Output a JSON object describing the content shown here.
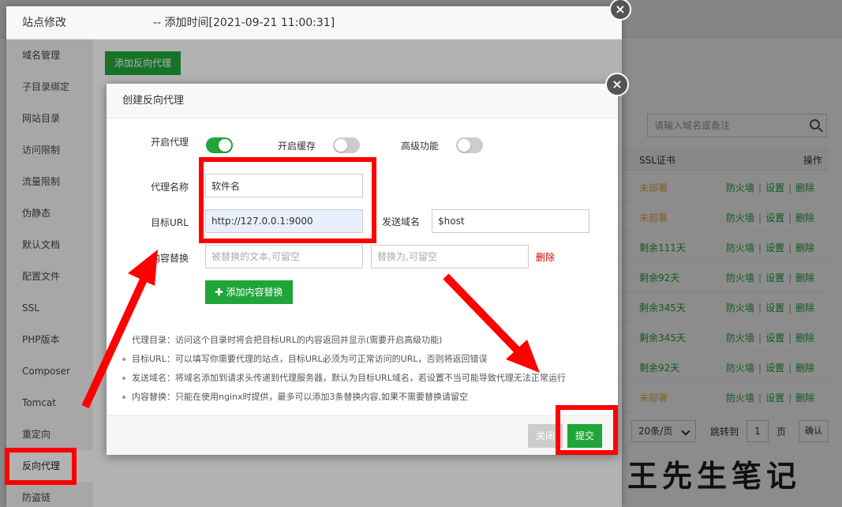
{
  "background": {
    "search_placeholder": "请输入域名或备注",
    "table_header": {
      "ssl": "SSL证书",
      "ops": "操作"
    },
    "rows": [
      {
        "ssl": "未部署",
        "status": "warn"
      },
      {
        "ssl": "未部署",
        "status": "warn"
      },
      {
        "ssl": "剩余111天",
        "status": "ok"
      },
      {
        "ssl": "剩余92天",
        "status": "ok"
      },
      {
        "ssl": "剩余345天",
        "status": "ok"
      },
      {
        "ssl": "剩余345天",
        "status": "ok"
      },
      {
        "ssl": "剩余92天",
        "status": "ok"
      },
      {
        "ssl": "未部署",
        "status": "warn"
      }
    ],
    "row_ops": {
      "firewall": "防火墙",
      "settings": "设置",
      "delete": "删除",
      "sep": "|"
    },
    "pager": {
      "per_page": "20条/页",
      "goto": "跳转到",
      "page": "1",
      "page_unit": "页",
      "confirm": "确认"
    }
  },
  "site_layer": {
    "title_prefix": "站点修改",
    "title_suffix": "-- 添加时间[2021-09-21 11:00:31]",
    "close": "×",
    "menu": [
      "域名管理",
      "子目录绑定",
      "网站目录",
      "访问限制",
      "流量限制",
      "伪静态",
      "默认文档",
      "配置文件",
      "SSL",
      "PHP版本",
      "Composer",
      "Tomcat",
      "重定向",
      "反向代理",
      "防盗链"
    ],
    "active_menu": "反向代理",
    "add_proxy_button": "添加反向代理"
  },
  "dialog": {
    "title": "创建反向代理",
    "close": "×",
    "enable_proxy_label": "开启代理",
    "enable_proxy": true,
    "enable_cache_label": "开启缓存",
    "enable_cache": false,
    "advanced_label": "高级功能",
    "advanced": false,
    "proxy_name_label": "代理名称",
    "proxy_name": "软件名",
    "target_url_label": "目标URL",
    "target_url": "http://127.0.0.1:9000",
    "send_domain_label": "发送域名",
    "send_domain": "$host",
    "replace_label": "内容替换",
    "replace_from_placeholder": "被替换的文本,可留空",
    "replace_to_placeholder": "替换为,可留空",
    "delete_label": "删除",
    "add_replace_button": "添加内容替换",
    "notes": [
      "代理目录：访问这个目录时将会把目标URL的内容返回并显示(需要开启高级功能)",
      "目标URL：可以填写你需要代理的站点，目标URL必须为可正常访问的URL，否则将返回错误",
      "发送域名：将域名添加到请求头传递到代理服务器，默认为目标URL域名，若设置不当可能导致代理无法正常运行",
      "内容替换：只能在使用nginx时提供，最多可以添加3条替换内容,如果不需要替换请留空"
    ],
    "close_button": "关闭",
    "submit_button": "提交"
  },
  "watermark": "王先生笔记",
  "colors": {
    "accent": "#20a53a",
    "annotation": "#ff0000",
    "warn": "#f0ad4e",
    "danger": "#cc0000"
  }
}
